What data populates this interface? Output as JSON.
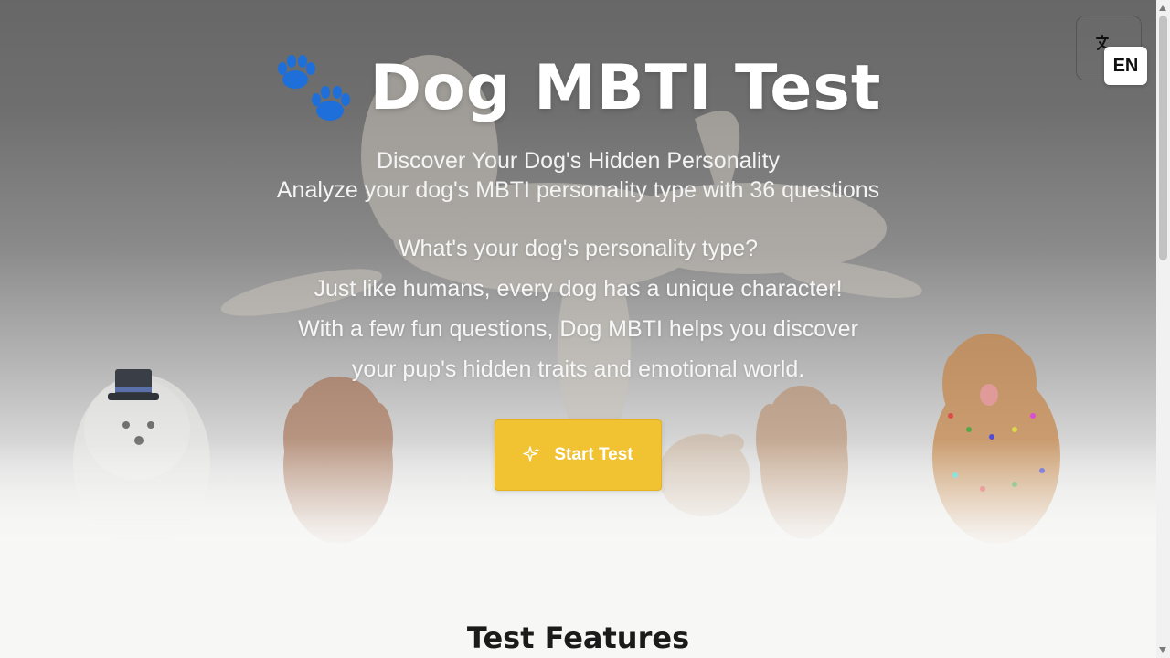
{
  "hero": {
    "title": "Dog MBTI Test",
    "subtitle_line1": "Discover Your Dog's Hidden Personality",
    "subtitle_line2": "Analyze your dog's MBTI personality type with 36 questions",
    "intro_lines": [
      "What's your dog's personality type?",
      "Just like humans, every dog has a unique character!",
      "With a few fun questions, Dog MBTI helps you discover",
      "your pup's hidden traits and emotional world."
    ],
    "start_button_label": "Start Test",
    "title_icon": "paw-print-icon",
    "button_icon": "sparkle-icon",
    "background_image": "dogs-collage-photo"
  },
  "language_switcher": {
    "icon": "translate-icon",
    "current_language": "EN"
  },
  "features": {
    "title": "Test Features"
  },
  "colors": {
    "accent": "#f1c232",
    "paw_icon": "#1e6fd9",
    "page_background": "#f7f7f6"
  }
}
